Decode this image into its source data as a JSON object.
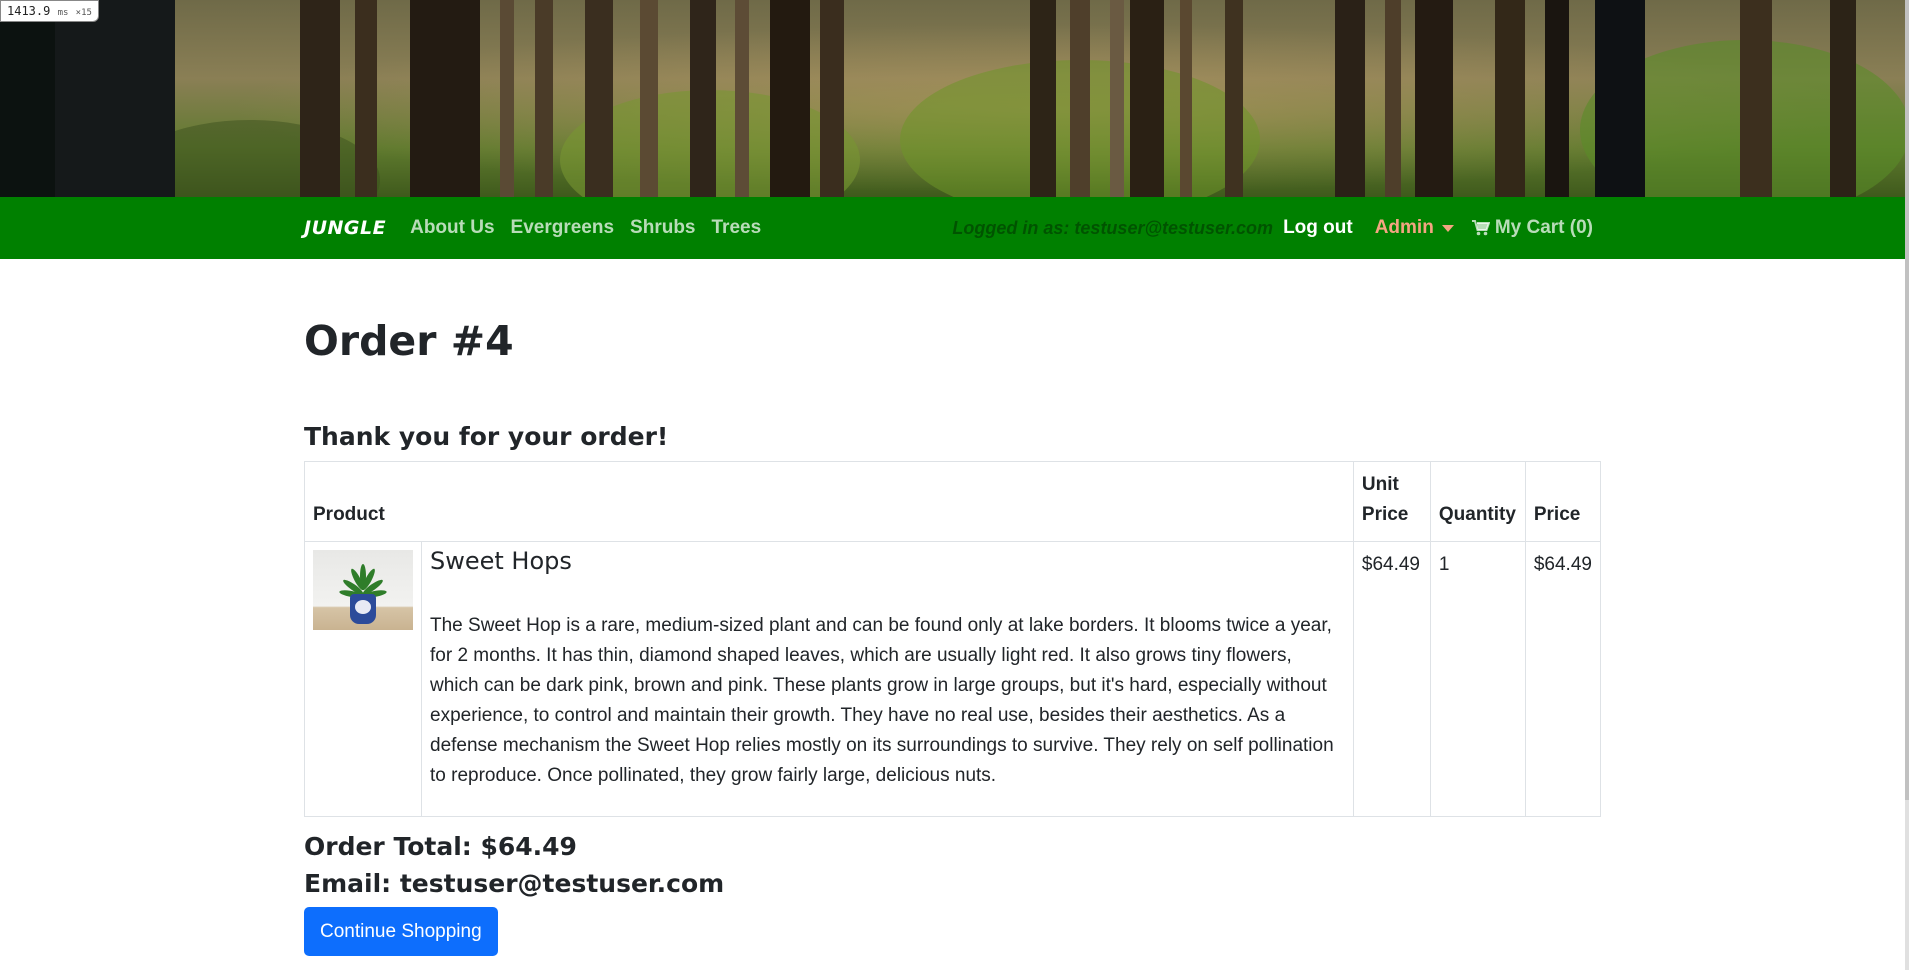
{
  "perf_badge": {
    "value": "1413.9",
    "unit": "ms",
    "suffix": "×15"
  },
  "nav": {
    "brand": "JUNGLE",
    "links": [
      "About Us",
      "Evergreens",
      "Shrubs",
      "Trees"
    ],
    "logged_in": "Logged in as: testuser@testuser.com",
    "logout": "Log out",
    "admin": "Admin",
    "cart": "My Cart (0)"
  },
  "order": {
    "title": "Order #4",
    "thanks": "Thank you for your order!",
    "table_headers": {
      "product": "Product",
      "unit_price": "Unit Price",
      "quantity": "Quantity",
      "price": "Price"
    },
    "items": [
      {
        "name": "Sweet Hops",
        "description": "The Sweet Hop is a rare, medium-sized plant and can be found only at lake borders. It blooms twice a year, for 2 months. It has thin, diamond shaped leaves, which are usually light red. It also grows tiny flowers, which can be dark pink, brown and pink. These plants grow in large groups, but it's hard, especially without experience, to control and maintain their growth. They have no real use, besides their aesthetics. As a defense mechanism the Sweet Hop relies mostly on its surroundings to survive. They rely on self pollination to reproduce. Once pollinated, they grow fairly large, delicious nuts.",
        "unit_price": "$64.49",
        "quantity": "1",
        "price": "$64.49"
      }
    ],
    "total": "Order Total: $64.49",
    "email": "Email: testuser@testuser.com",
    "continue_button": "Continue Shopping"
  },
  "colors": {
    "navbar": "#008000",
    "admin": "#f4a582",
    "button": "#0d6efd"
  }
}
